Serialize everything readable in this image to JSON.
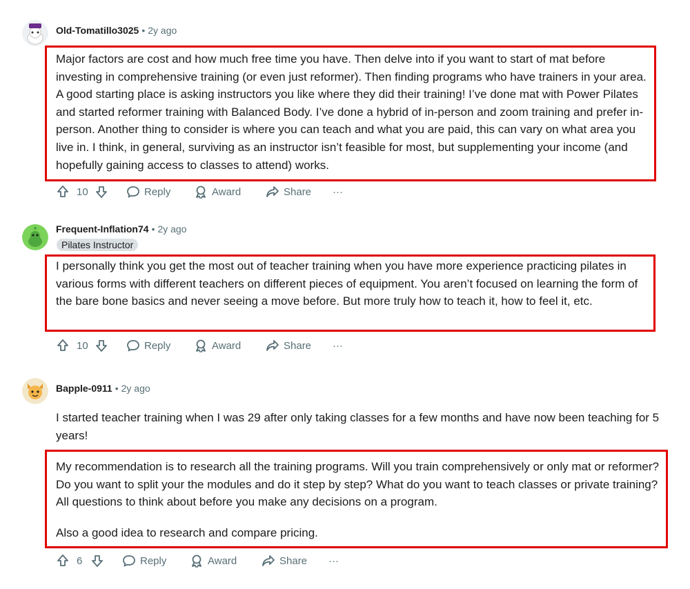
{
  "comments": [
    {
      "author": "Old-Tomatillo3025",
      "age": "2y ago",
      "paragraphs": [
        "Major factors are cost and how much free time you have. Then delve into if you want to start of mat before investing in comprehensive training (or even just reformer). Then finding programs who have trainers in your area. A good starting place is asking instructors you like where they did their training! I’ve done mat with Power Pilates and started reformer training with Balanced Body. I’ve done a hybrid of in-person and zoom training and prefer in-person. Another thing to consider is where you can teach and what you are paid, this can vary on what area you live in. I think, in general, surviving as an instructor isn’t feasible for most, but supplementing your income (and hopefully gaining access to classes to attend) works."
      ],
      "score": "10"
    },
    {
      "author": "Frequent-Inflation74",
      "age": "2y ago",
      "flair": "Pilates Instructor",
      "paragraphs": [
        "I personally think you get the most out of teacher training when you have more experience practicing pilates in various forms with different teachers on different pieces of equipment. You aren’t focused on learning the form of the bare bone basics and never seeing a move before. But more truly how to teach it, how to feel it, etc."
      ],
      "score": "10"
    },
    {
      "author": "Bapple-0911",
      "age": "2y ago",
      "paragraphs": [
        "I started teacher training when I was 29 after only taking classes for a few months and have now been teaching for 5 years!",
        "My recommendation is to research all the training programs. Will you train comprehensively or only mat or reformer? Do you want to split your the modules and do it step by step? What do you want to teach classes or private training? All questions to think about before you make any decisions on a program.",
        "Also a good idea to research and compare pricing."
      ],
      "score": "6"
    }
  ],
  "actions": {
    "reply": "Reply",
    "award": "Award",
    "share": "Share",
    "more": "···"
  },
  "colors": {
    "highlight_border": "#e00000",
    "meta_gray": "#576f76",
    "flair_bg": "#dbe0e3"
  },
  "icons": [
    "upvote-icon",
    "downvote-icon",
    "reply-icon",
    "award-icon",
    "share-icon",
    "more-icon"
  ]
}
